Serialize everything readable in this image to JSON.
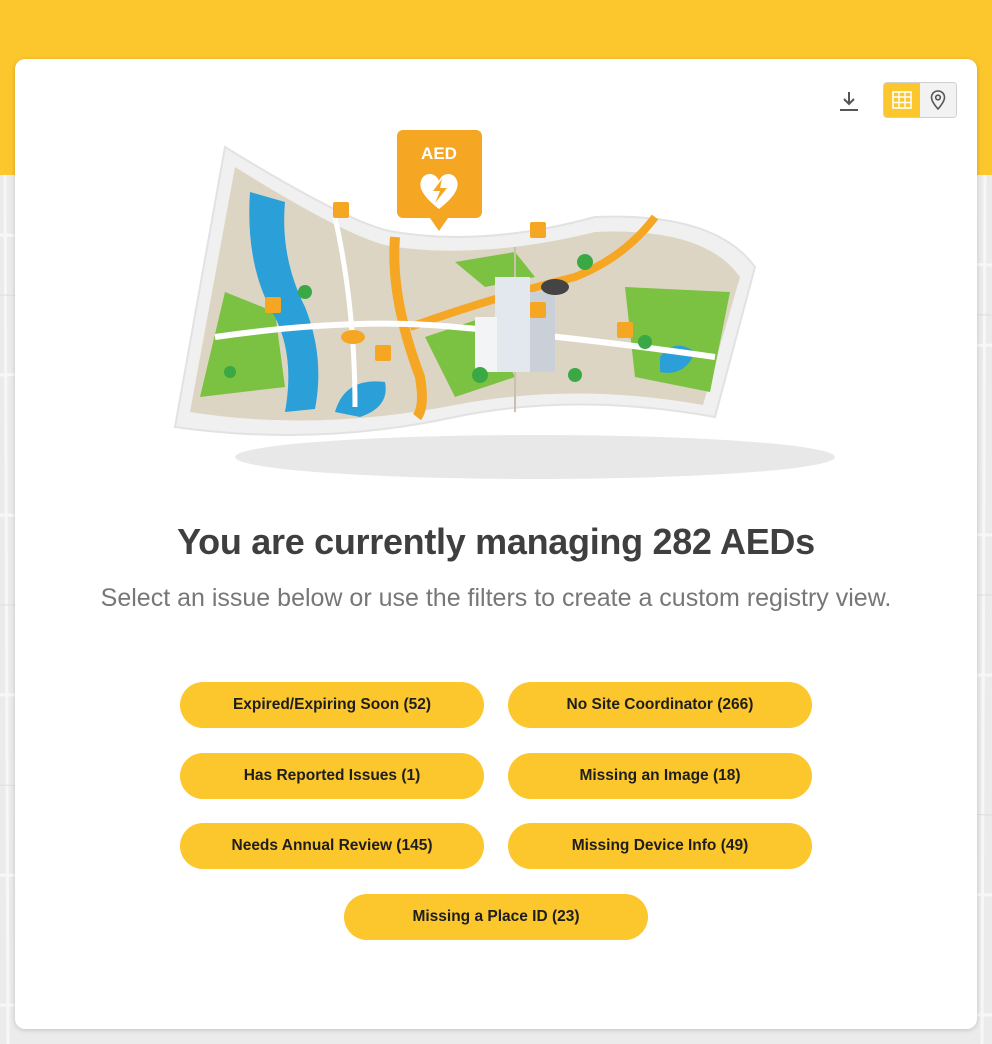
{
  "colors": {
    "accent": "#fcc62d",
    "card": "#ffffff",
    "headline": "#3f3f3f",
    "subline": "#777777"
  },
  "toolbar": {
    "download_icon": "download-icon",
    "table_view_icon": "table-grid-icon",
    "map_view_icon": "map-pin-icon",
    "active_view": "table"
  },
  "hero": {
    "badge_text": "AED",
    "marker_text": "AED"
  },
  "headline": "You are currently managing 282 AEDs",
  "subline": "Select an issue below or use the filters to create a custom registry view.",
  "issues": [
    {
      "label": "Expired/Expiring Soon (52)"
    },
    {
      "label": "No Site Coordinator (266)"
    },
    {
      "label": "Has Reported Issues (1)"
    },
    {
      "label": "Missing an Image (18)"
    },
    {
      "label": "Needs Annual Review (145)"
    },
    {
      "label": "Missing Device Info (49)"
    },
    {
      "label": "Missing a Place ID (23)"
    }
  ]
}
